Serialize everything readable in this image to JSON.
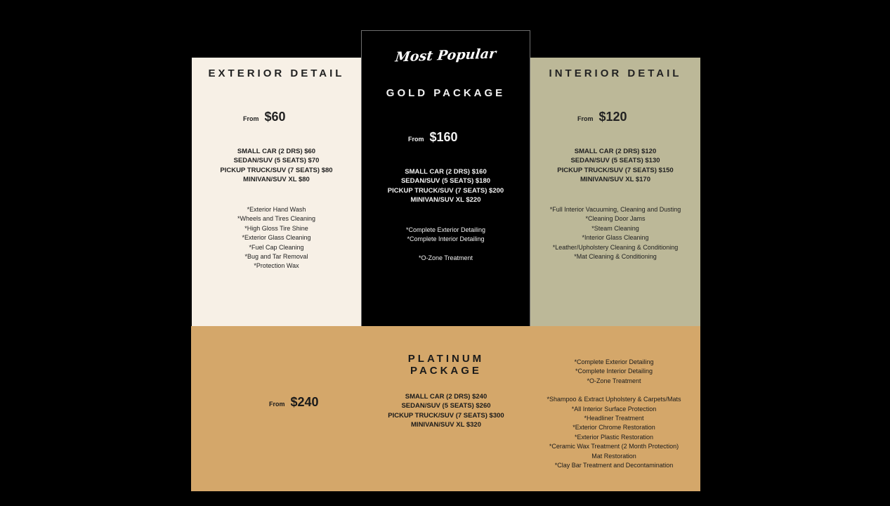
{
  "exterior": {
    "title": "EXTERIOR DETAIL",
    "from_label": "From",
    "price": "$60",
    "sizes": [
      "SMALL CAR (2 DRS) $60",
      "SEDAN/SUV (5 SEATS) $70",
      "PICKUP TRUCK/SUV (7 SEATS) $80",
      "MINIVAN/SUV XL $80"
    ],
    "features": [
      "*Exterior Hand Wash",
      "*Wheels and Tires Cleaning",
      "*High Gloss Tire Shine",
      "*Exterior Glass Cleaning",
      "*Fuel Cap Cleaning",
      "*Bug and Tar Removal",
      "*Protection Wax"
    ]
  },
  "gold": {
    "badge": "Most Popular",
    "title": "GOLD PACKAGE",
    "from_label": "From",
    "price": "$160",
    "sizes": [
      "SMALL CAR (2 DRS) $160",
      "SEDAN/SUV (5 SEATS) $180",
      "PICKUP TRUCK/SUV (7 SEATS) $200",
      "MINIVAN/SUV XL $220"
    ],
    "features": [
      "*Complete Exterior Detailing",
      "*Complete Interior Detailing",
      "*O-Zone Treatment"
    ]
  },
  "interior": {
    "title": "INTERIOR DETAIL",
    "from_label": "From",
    "price": "$120",
    "sizes": [
      "SMALL CAR (2 DRS) $120",
      "SEDAN/SUV (5 SEATS) $130",
      "PICKUP TRUCK/SUV (7 SEATS) $150",
      "MINIVAN/SUV XL $170"
    ],
    "features": [
      "*Full Interior Vacuuming, Cleaning and Dusting",
      "*Cleaning Door Jams",
      "*Steam Cleaning",
      "*Interior Glass Cleaning",
      "*Leather/Upholstery Cleaning & Conditioning",
      "*Mat Cleaning & Conditioning"
    ]
  },
  "platinum": {
    "title": "PLATINUM PACKAGE",
    "from_label": "From",
    "price": "$240",
    "sizes": [
      "SMALL CAR (2 DRS) $240",
      "SEDAN/SUV (5 SEATS) $260",
      "PICKUP TRUCK/SUV (7 SEATS) $300",
      "MINIVAN/SUV XL $320"
    ],
    "features_group_1": [
      "*Complete Exterior Detailing",
      "*Complete Interior Detailing",
      "*O-Zone Treatment"
    ],
    "features_group_2": [
      "*Shampoo & Extract Upholstery & Carpets/Mats",
      "*All Interior Surface Protection",
      "*Headliner Treatment",
      "*Exterior Chrome Restoration",
      "*Exterior Plastic Restoration",
      "*Ceramic Wax Treatment (2 Month Protection)",
      "Mat Restoration",
      "*Clay Bar Treatment and Decontamination"
    ]
  },
  "colors": {
    "background": "#000000",
    "exterior_card": "#f7f0e6",
    "gold_card": "#000000",
    "interior_card": "#bcb898",
    "platinum_card": "#d4a76a"
  }
}
